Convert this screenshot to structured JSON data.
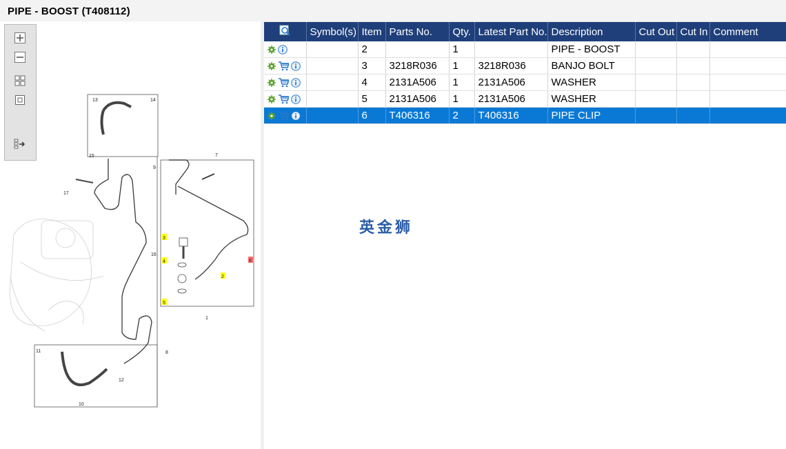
{
  "window": {
    "title": "PIPE - BOOST (T408112)"
  },
  "toolbar": {
    "icons": [
      "zoom-in-icon",
      "zoom-out-icon",
      "fit-page-icon",
      "actual-size-icon",
      "export-icon"
    ]
  },
  "diagram": {
    "callouts": [
      "13",
      "14",
      "15",
      "9",
      "7",
      "17",
      "16",
      "3",
      "4",
      "2",
      "5",
      "6",
      "1",
      "11",
      "8",
      "12",
      "10"
    ]
  },
  "grid": {
    "columns": [
      "",
      "Symbol(s)",
      "Item",
      "Parts No.",
      "Qty.",
      "Latest Part No.",
      "Description",
      "Cut Out",
      "Cut In",
      "Comment"
    ],
    "rows": [
      {
        "item": "2",
        "parts_no": "",
        "qty": "1",
        "latest": "",
        "description": "PIPE - BOOST",
        "cart": false,
        "selected": false
      },
      {
        "item": "3",
        "parts_no": "3218R036",
        "qty": "1",
        "latest": "3218R036",
        "description": "BANJO BOLT",
        "cart": true,
        "selected": false
      },
      {
        "item": "4",
        "parts_no": "2131A506",
        "qty": "1",
        "latest": "2131A506",
        "description": "WASHER",
        "cart": true,
        "selected": false
      },
      {
        "item": "5",
        "parts_no": "2131A506",
        "qty": "1",
        "latest": "2131A506",
        "description": "WASHER",
        "cart": true,
        "selected": false
      },
      {
        "item": "6",
        "parts_no": "T406316",
        "qty": "2",
        "latest": "T406316",
        "description": "PIPE CLIP",
        "cart": true,
        "selected": true
      }
    ]
  },
  "watermark": "英金狮",
  "colors": {
    "header_bg": "#1f3f7a",
    "selected_row": "#0a79d6",
    "gear": "#5aa02c",
    "info": "#2a78c8",
    "callout_highlight": "#ffff00"
  }
}
